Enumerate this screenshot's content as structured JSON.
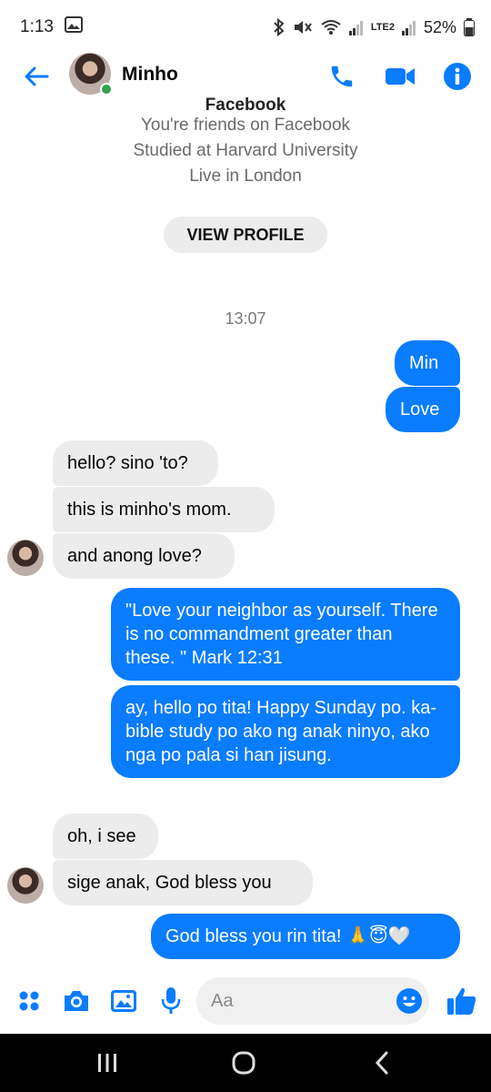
{
  "status_bar": {
    "time": "1:13",
    "battery": "52%",
    "network": "LTE2"
  },
  "header": {
    "title": "Minho",
    "accent": "#0a7cff",
    "online_color": "#31a24c"
  },
  "profile": {
    "top_line": "Facebook",
    "lines": [
      "You're friends on Facebook",
      "Studied at Harvard University",
      "Live in London"
    ],
    "button": "VIEW PROFILE"
  },
  "timestamp": "13:07",
  "messages": [
    {
      "dir": "out",
      "text": "Min"
    },
    {
      "dir": "out",
      "text": "Love"
    },
    {
      "dir": "in",
      "text": "hello? sino 'to?"
    },
    {
      "dir": "in",
      "text": "this is minho's mom."
    },
    {
      "dir": "in",
      "text": "and anong love?"
    },
    {
      "dir": "out",
      "text": "\"Love your neighbor as yourself. There is no commandment greater than these. \" Mark 12:31"
    },
    {
      "dir": "out",
      "text": "ay, hello po tita! Happy Sunday po. ka-bible study po ako ng anak ninyo, ako nga po pala si han jisung."
    },
    {
      "dir": "in",
      "text": "oh, i see"
    },
    {
      "dir": "in",
      "text": "sige anak, God bless you"
    },
    {
      "dir": "out",
      "text": "God bless you rin tita! 🙏😇🤍"
    }
  ],
  "composer": {
    "placeholder": "Aa"
  },
  "colors": {
    "outgoing": "#0a7cff",
    "incoming": "#ececec",
    "muted": "#6a6a6a"
  }
}
